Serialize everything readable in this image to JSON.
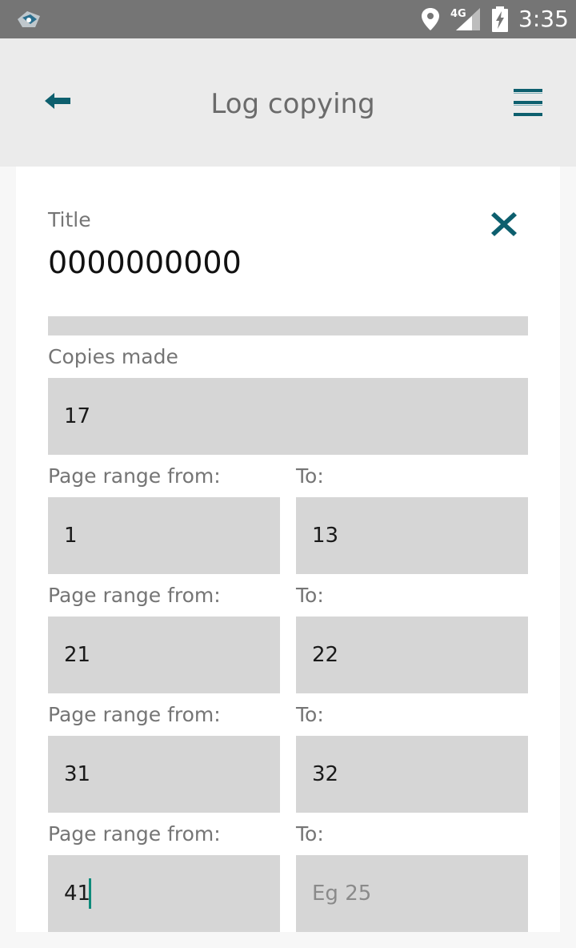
{
  "status_bar": {
    "time": "3:35",
    "network": "4G",
    "icons": [
      "app-logo-icon",
      "location-icon",
      "signal-icon",
      "battery-charging-icon"
    ]
  },
  "header": {
    "title": "Log copying",
    "back_icon": "back-arrow-icon",
    "menu_icon": "hamburger-menu-icon",
    "accent_color": "#0d5f6e"
  },
  "form": {
    "title_label": "Title",
    "title_value": "0000000000",
    "close_icon": "close-icon",
    "copies_label": "Copies made",
    "copies_value": "17",
    "ranges": [
      {
        "from_label": "Page range from:",
        "to_label": "To:",
        "from_value": "1",
        "to_value": "13",
        "to_placeholder": ""
      },
      {
        "from_label": "Page range from:",
        "to_label": "To:",
        "from_value": "21",
        "to_value": "22",
        "to_placeholder": ""
      },
      {
        "from_label": "Page range from:",
        "to_label": "To:",
        "from_value": "31",
        "to_value": "32",
        "to_placeholder": ""
      },
      {
        "from_label": "Page range from:",
        "to_label": "To:",
        "from_value": "41",
        "to_value": "",
        "to_placeholder": "Eg 25"
      }
    ]
  }
}
